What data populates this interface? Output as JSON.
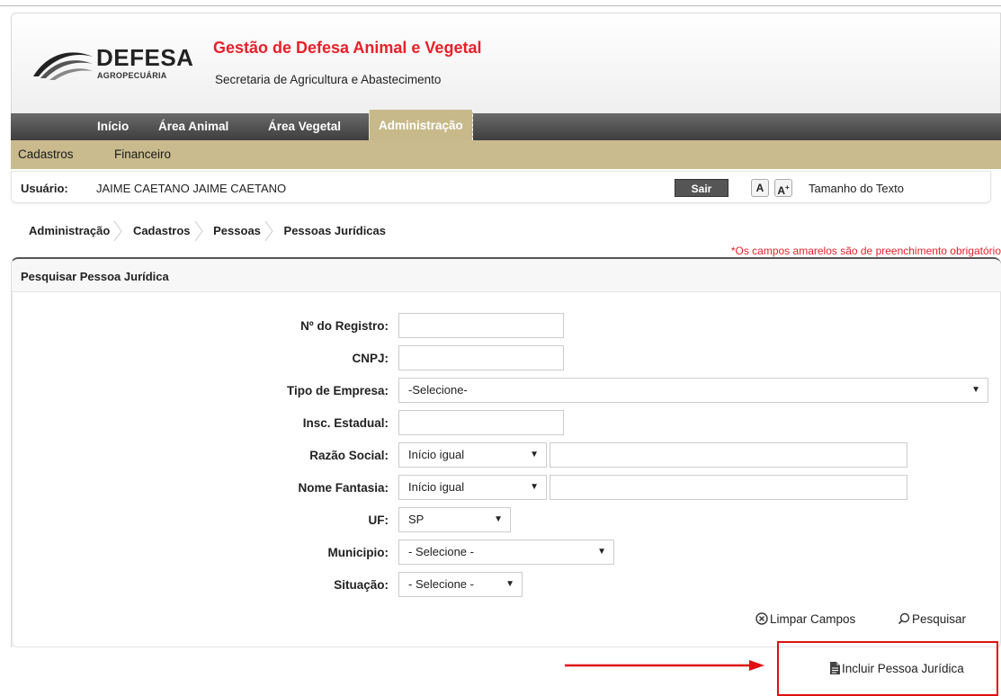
{
  "header": {
    "logo_word": "DEFESA",
    "logo_sub": "AGROPECUÁRIA",
    "title": "Gestão de Defesa Animal e Vegetal",
    "subtitle": "Secretaria de Agricultura e Abastecimento"
  },
  "nav": {
    "items": [
      {
        "label": "Início"
      },
      {
        "label": "Área Animal"
      },
      {
        "label": "Área Vegetal"
      },
      {
        "label": "Administração",
        "active": true
      }
    ]
  },
  "subnav": {
    "items": [
      {
        "label": "Cadastros"
      },
      {
        "label": "Financeiro"
      }
    ]
  },
  "userbar": {
    "user_label": "Usuário:",
    "user_name": "JAIME CAETANO JAIME CAETANO",
    "logout_label": "Sair",
    "font_decrease": "A",
    "font_increase": "A",
    "font_increase_sup": "+",
    "font_size_label": "Tamanho do Texto"
  },
  "breadcrumb": [
    "Administração",
    "Cadastros",
    "Pessoas",
    "Pessoas Jurídicas"
  ],
  "required_note": "*Os campos amarelos são de preenchimento obrigatório",
  "search": {
    "title": "Pesquisar Pessoa Jurídica",
    "fields": {
      "registro": {
        "label": "Nº do Registro:",
        "value": ""
      },
      "cnpj": {
        "label": "CNPJ:",
        "value": ""
      },
      "tipo_empresa": {
        "label": "Tipo de Empresa:",
        "selected": "-Selecione-"
      },
      "insc_estadual": {
        "label": "Insc. Estadual:",
        "value": ""
      },
      "razao_social": {
        "label": "Razão Social:",
        "mode": "Início igual",
        "value": ""
      },
      "nome_fantasia": {
        "label": "Nome Fantasia:",
        "mode": "Início igual",
        "value": ""
      },
      "uf": {
        "label": "UF:",
        "selected": "SP"
      },
      "municipio": {
        "label": "Municipio:",
        "selected": "- Selecione -"
      },
      "situacao": {
        "label": "Situação:",
        "selected": "- Selecione -"
      }
    },
    "clear_label": "Limpar Campos",
    "search_label": "Pesquisar"
  },
  "include_label": "Incluir Pessoa Jurídica",
  "colors": {
    "title_red": "#e8202a",
    "nav_dark": "#4a4a4a",
    "nav_active": "#c8b98a",
    "highlight_red": "#e01010"
  }
}
